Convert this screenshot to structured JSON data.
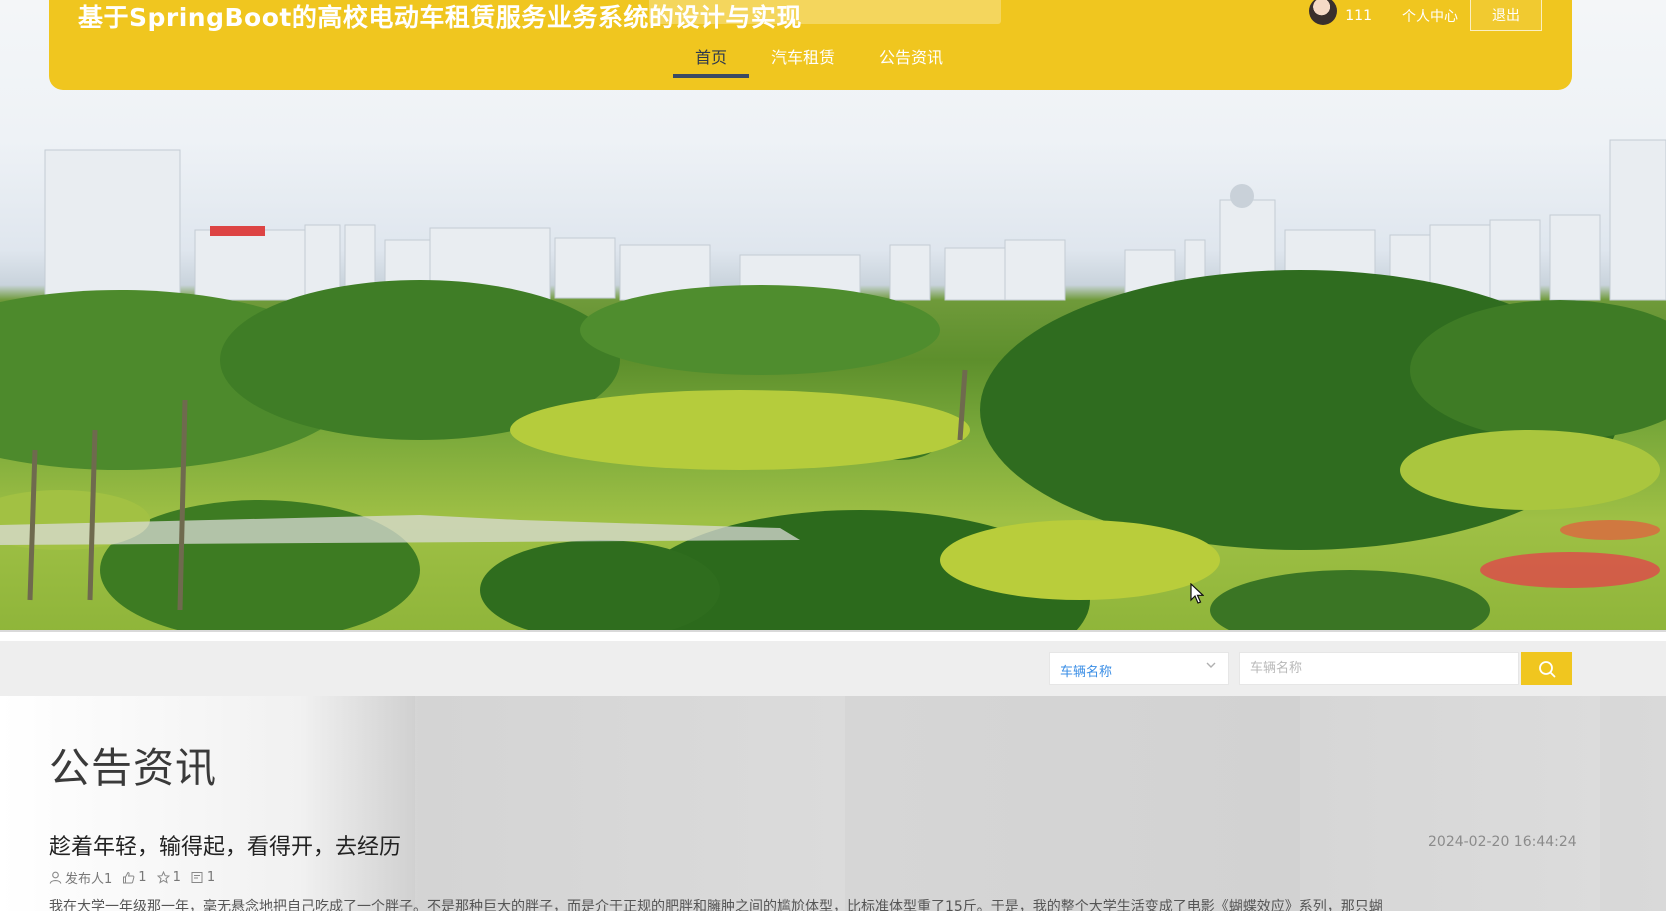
{
  "header": {
    "site_title": "基于SpringBoot的高校电动车租赁服务业务系统的设计与实现",
    "nav": [
      {
        "label": "首页",
        "active": true
      },
      {
        "label": "汽车租赁",
        "active": false
      },
      {
        "label": "公告资讯",
        "active": false
      }
    ],
    "user": {
      "name": "111",
      "center_label": "个人中心",
      "logout_label": "退出"
    }
  },
  "search": {
    "field_select": "车辆名称",
    "input_placeholder": "车辆名称",
    "button_icon": "search-icon"
  },
  "news": {
    "heading": "公告资讯",
    "article": {
      "title": "趁着年轻，输得起，看得开，去经历",
      "date": "2024-02-20 16:44:24",
      "author": "发布人1",
      "likes": "1",
      "favorites": "1",
      "comments": "1",
      "excerpt": "我在大学一年级那一年，毫无悬念地把自己吃成了一个胖子。不是那种巨大的胖子，而是介于正规的肥胖和臃肿之间的尴尬体型，比标准体型重了15斤。于是，我的整个大学生活变成了电影《蝴蝶效应》系列，那只蝴"
    }
  },
  "colors": {
    "brand": "#f0c61f",
    "nav_active": "#2f3a4d",
    "select_text": "#3a8ee6"
  }
}
